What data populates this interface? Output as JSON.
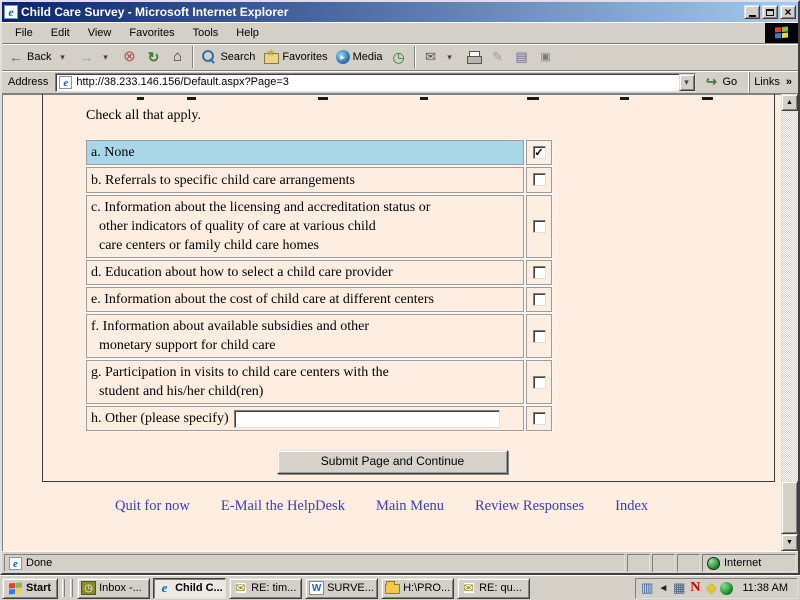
{
  "titlebar": {
    "title": "Child Care Survey - Microsoft Internet Explorer"
  },
  "menubar": {
    "items": [
      "File",
      "Edit",
      "View",
      "Favorites",
      "Tools",
      "Help"
    ]
  },
  "toolbar": {
    "back_label": "Back",
    "search_label": "Search",
    "favorites_label": "Favorites",
    "media_label": "Media"
  },
  "addressbar": {
    "label": "Address",
    "url": "http://38.233.146.156/Default.aspx?Page=3",
    "go_label": "Go",
    "links_label": "Links",
    "chevrons": "»"
  },
  "page": {
    "instruction": "Check all that apply.",
    "options": [
      {
        "lines": [
          "a. None"
        ],
        "checked": true,
        "highlight": true
      },
      {
        "lines": [
          "b. Referrals to specific child care arrangements"
        ],
        "checked": false
      },
      {
        "lines": [
          "c. Information about the licensing and accreditation status or",
          "other indicators of quality of care at various child",
          "care centers or family child care homes"
        ],
        "checked": false
      },
      {
        "lines": [
          "d. Education about how to select a child care provider"
        ],
        "checked": false
      },
      {
        "lines": [
          "e. Information about the cost of child care at different centers"
        ],
        "checked": false
      },
      {
        "lines": [
          "f. Information about available subsidies and other",
          "monetary support for child care"
        ],
        "checked": false
      },
      {
        "lines": [
          "g. Participation in visits to child care centers with the",
          "student and his/her child(ren)"
        ],
        "checked": false
      },
      {
        "lines": [
          "h. Other (please specify)"
        ],
        "checked": false,
        "has_input": true,
        "input_value": ""
      }
    ],
    "submit_label": "Submit Page and Continue",
    "footer_links": [
      "Quit for now",
      "E-Mail the HelpDesk",
      "Main Menu",
      "Review Responses",
      "Index"
    ]
  },
  "statusbar": {
    "left": "Done",
    "right": "Internet"
  },
  "taskbar": {
    "start_label": "Start",
    "tasks": [
      {
        "label": "Inbox -...",
        "icon": "outlook-inbox-icon",
        "active": false
      },
      {
        "label": "Child C...",
        "icon": "ie-icon",
        "active": true
      },
      {
        "label": "RE: tim...",
        "icon": "mail-message-icon",
        "active": false
      },
      {
        "label": "SURVE...",
        "icon": "word-doc-icon",
        "active": false
      },
      {
        "label": "H:\\PRO...",
        "icon": "folder-icon",
        "active": false
      },
      {
        "label": "RE: qu...",
        "icon": "mail-message-icon",
        "active": false
      }
    ],
    "clock": "11:38 AM"
  },
  "icons": {
    "ie-logo-icon": "blue italic e",
    "back-icon": "left arrow",
    "forward-icon": "right arrow",
    "dropdown-icon": "small down triangle",
    "stop-icon": "circled x",
    "refresh-icon": "circular arrows",
    "home-icon": "house",
    "search-icon": "magnifier",
    "favorites-icon": "folder with star",
    "media-icon": "blue orb with play",
    "history-icon": "clock",
    "mail-icon": "envelope",
    "print-icon": "printer",
    "edit-icon": "pencil",
    "discuss-icon": "page",
    "messenger-icon": "small square",
    "go-icon": "curved arrow",
    "links-chevron-icon": "double chevron",
    "globe-icon": "green globe",
    "checkmark-icon": "check mark",
    "minimize-icon": "underscore",
    "restore-icon": "overlapping windows",
    "close-icon": "x",
    "windows-flag-icon": "four color flag",
    "scroll-up-icon": "up triangle",
    "scroll-down-icon": "down triangle",
    "display-tray-icon": "monitor",
    "volume-tray-icon": "speaker",
    "network-tray-icon": "two computers",
    "norton-tray-icon": "red N",
    "shield-tray-icon": "yellow shield",
    "green-globe-tray-icon": "green sphere"
  },
  "colors": {
    "titlebar_start": "#0a246a",
    "titlebar_end": "#a6caf0",
    "chrome": "#d4d0c8",
    "page_bg": "#fdeee1",
    "highlight_row": "#a9d7e7",
    "link_blue": "#3c3cbe"
  }
}
